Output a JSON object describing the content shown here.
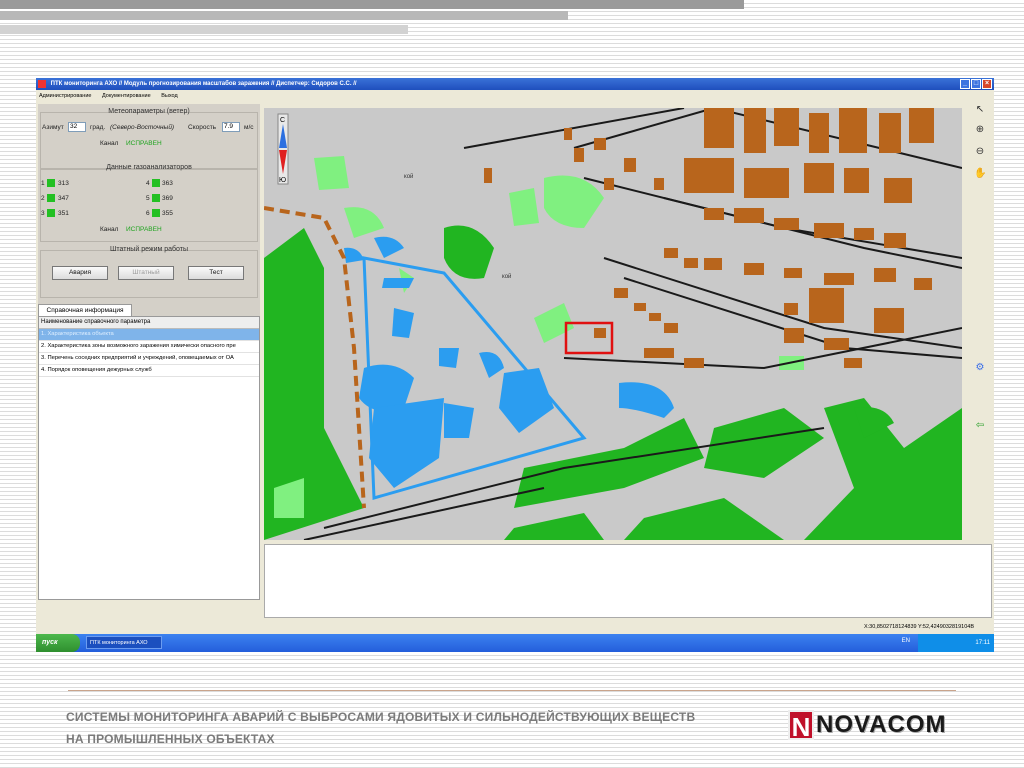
{
  "slide": {
    "caption_line1": "СИСТЕМЫ МОНИТОРИНГА АВАРИЙ С ВЫБРОСАМИ ЯДОВИТЫХ И СИЛЬНОДЕЙСТВУЮЩИХ ВЕЩЕСТВ",
    "caption_line2": "НА ПРОМЫШЛЕННЫХ ОБЪЕКТАХ",
    "logo_letter": "N",
    "logo_text": "NOVACOM"
  },
  "window": {
    "title": "ПТК мониторинга  АХО // Модуль прогнозирования масштабов заражения // Диспетчер: Сидоров С.С. //",
    "menu": [
      "Администрирование",
      "Документирование",
      "Выход"
    ]
  },
  "weather": {
    "title": "Метеопараметры (ветер)",
    "azimuth_label": "Азимут",
    "azimuth_value": "32",
    "unit_deg": "град.",
    "direction": "(Северо-Восточный)",
    "speed_label": "Скорость",
    "speed_value": "7.9",
    "unit_speed": "м/с",
    "channel_label": "Канал",
    "channel_status": "ИСПРАВЕН"
  },
  "gas": {
    "title": "Данные газоанализаторов",
    "sensors": [
      {
        "id": "1",
        "value": "313"
      },
      {
        "id": "2",
        "value": "347"
      },
      {
        "id": "3",
        "value": "351"
      },
      {
        "id": "4",
        "value": "363"
      },
      {
        "id": "5",
        "value": "369"
      },
      {
        "id": "6",
        "value": "355"
      }
    ],
    "channel_label": "Канал",
    "channel_status": "ИСПРАВЕН"
  },
  "mode": {
    "title": "Штатный режим работы",
    "buttons": [
      "Авария",
      "Штатный",
      "Тест"
    ]
  },
  "reference": {
    "tab": "Справочная информация",
    "header": "Наименование справочного параметра",
    "rows": [
      "1. Характеристика объекта",
      "2. Характеристика зоны возможного заражения химически опасного пре",
      "3. Перечень соседних предприятий и учреждений, оповещаемых от ОА",
      "4. Порядок оповещения дежурных служб"
    ]
  },
  "map": {
    "compass_top": "С",
    "compass_bottom": "Ю",
    "label_a": "кой",
    "label_b": "кой"
  },
  "status": {
    "coords": "X:30,8502718124839 Y:52,4249032819104B"
  },
  "taskbar": {
    "start": "пуск",
    "task": "ПТК мониторинга  АХО",
    "lang": "EN",
    "time": "17:11"
  },
  "colors": {
    "building": "#b8651c",
    "water": "#2b9df0",
    "forest": "#21b521",
    "light_green": "#80f080",
    "map_bg": "#c9c9c9",
    "rail": "#1a1a1a",
    "alert_box": "#e01010"
  }
}
